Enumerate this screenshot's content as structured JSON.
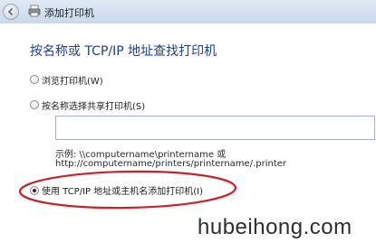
{
  "window": {
    "title": "添加打印机",
    "back_icon": "back-arrow-icon",
    "title_icon": "printer-icon"
  },
  "page": {
    "heading": "按名称或 TCP/IP 地址查找打印机"
  },
  "options": [
    {
      "label": "浏览打印机(W)",
      "selected": false
    },
    {
      "label": "按名称选择共享打印机(S)",
      "selected": false
    },
    {
      "label": "使用 TCP/IP 地址或主机名添加打印机(I)",
      "selected": true
    }
  ],
  "share_input": {
    "value": "",
    "placeholder": ""
  },
  "example": {
    "line1": "示例: \\\\computername\\printername 或",
    "line2": "http://computername/printers/printername/.printer"
  },
  "annotation": {
    "ellipse_color": "#c8232c"
  },
  "watermark": {
    "text": "hubeihong.com"
  },
  "colors": {
    "heading": "#1d3f8f",
    "titlebar": "#c9d9ec"
  }
}
